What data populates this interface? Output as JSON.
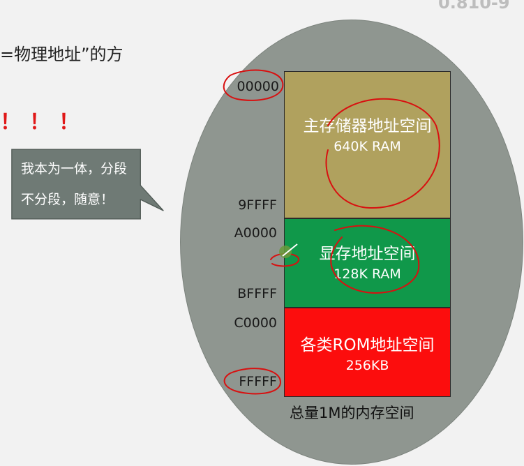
{
  "slide": {
    "title_fragment": "=物理地址”的方",
    "exclamation": "！！！",
    "watermark": "0.810-9"
  },
  "callout": {
    "line1": "我本为一体，分段",
    "line2": "不分段，随意！"
  },
  "memory_map": {
    "blocks": [
      {
        "name": "主存储器地址空间",
        "size": "640K RAM",
        "color": "#b0a15e"
      },
      {
        "name": "显存地址空间",
        "size": "128K RAM",
        "color": "#10984a"
      },
      {
        "name": "各类ROM地址空间",
        "size": "256KB",
        "color": "#fc0d0d"
      }
    ],
    "addresses": [
      "00000",
      "9FFFF",
      "A0000",
      "BFFFF",
      "C0000",
      "FFFFF"
    ],
    "caption": "总量1M的内存空间"
  }
}
